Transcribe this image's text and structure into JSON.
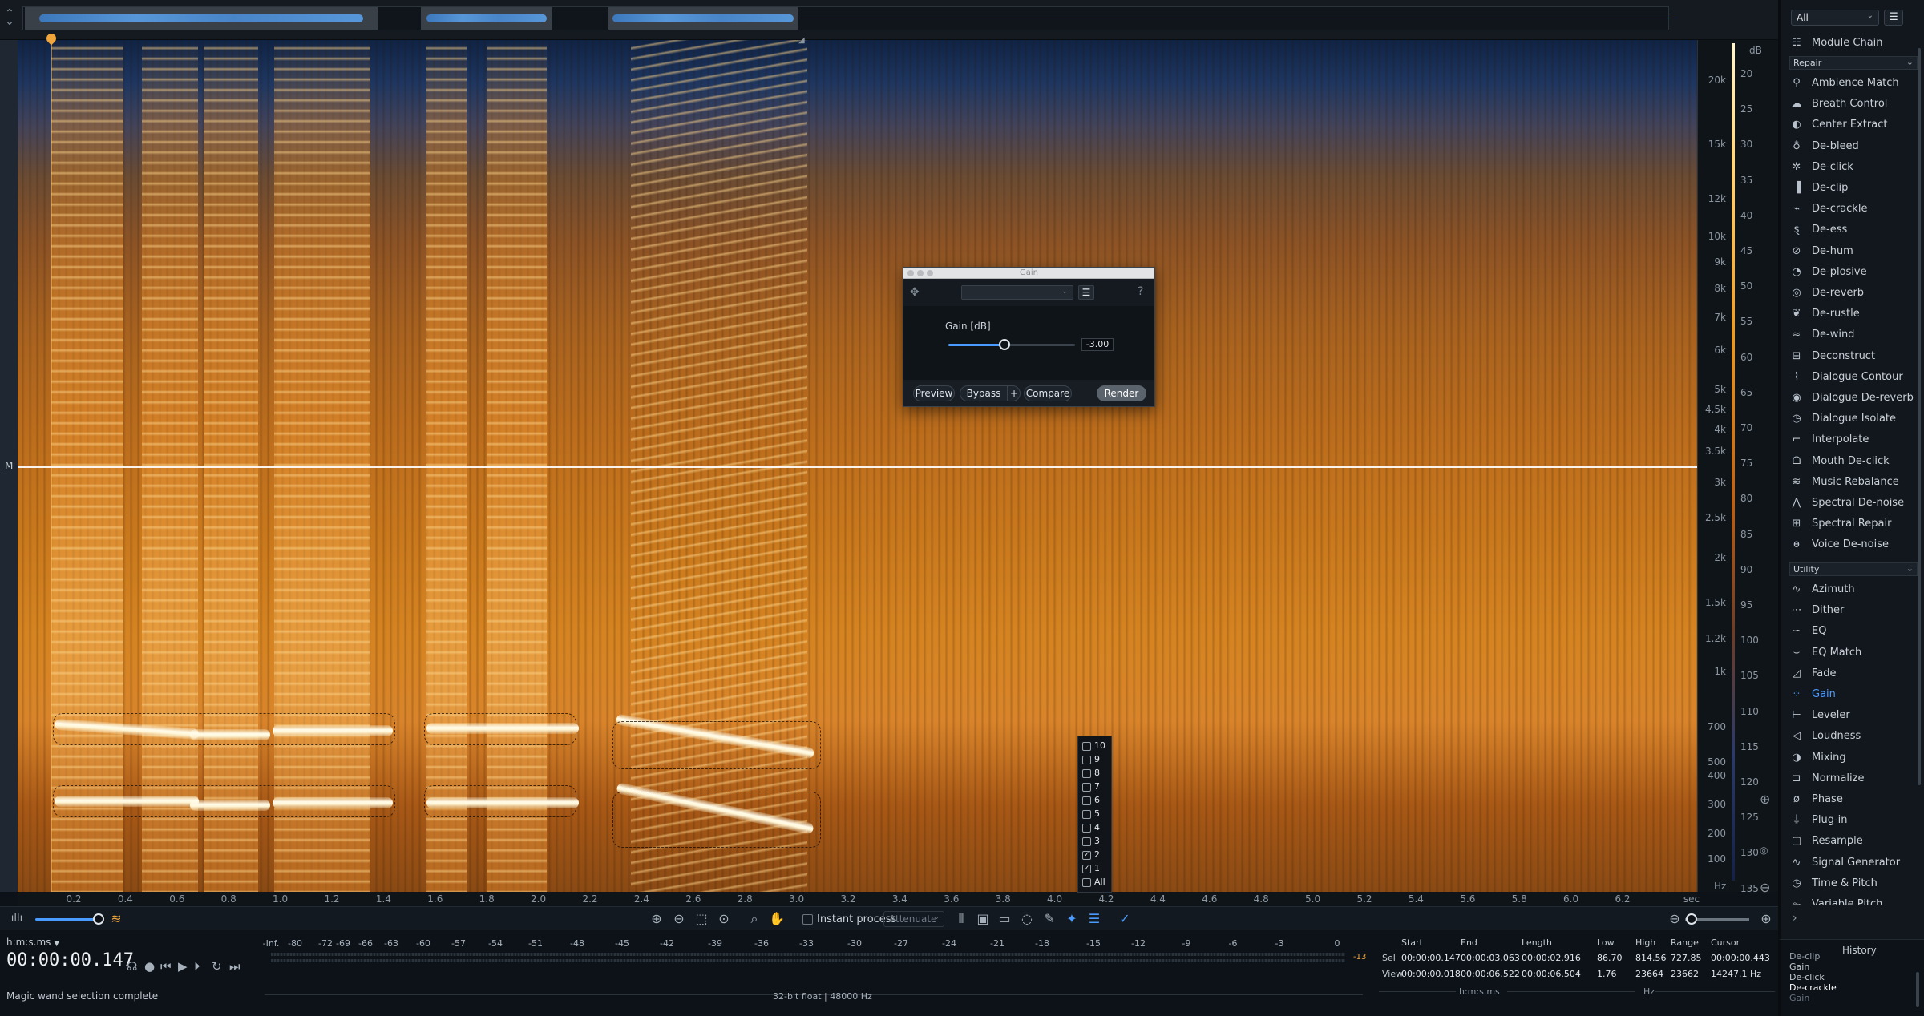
{
  "overview": {
    "collapse_icon": "collapse-icon"
  },
  "spectrogram": {
    "channel_label": "M",
    "freq_ticks": [
      "20k",
      "15k",
      "12k",
      "10k",
      "9k",
      "8k",
      "7k",
      "6k",
      "5k",
      "4.5k",
      "4k",
      "3.5k",
      "3k",
      "2.5k",
      "2k",
      "1.5k",
      "1.2k",
      "1k",
      "700",
      "500",
      "400",
      "300",
      "200",
      "100"
    ],
    "freq_unit": "Hz",
    "db_title": "dB",
    "db_ticks": [
      "20",
      "25",
      "30",
      "35",
      "40",
      "45",
      "50",
      "55",
      "60",
      "65",
      "70",
      "75",
      "80",
      "85",
      "90",
      "95",
      "100",
      "105",
      "110",
      "115",
      "120",
      "125",
      "130",
      "135"
    ],
    "time_ticks": [
      "0.2",
      "0.4",
      "0.6",
      "0.8",
      "1.0",
      "1.2",
      "1.4",
      "1.6",
      "1.8",
      "2.0",
      "2.2",
      "2.4",
      "2.6",
      "2.8",
      "3.0",
      "3.2",
      "3.4",
      "3.6",
      "3.8",
      "4.0",
      "4.2",
      "4.4",
      "4.6",
      "4.8",
      "5.0",
      "5.2",
      "5.4",
      "5.6",
      "5.8",
      "6.0",
      "6.2"
    ],
    "time_unit": "sec"
  },
  "gain_dialog": {
    "title": "Gain",
    "param_label": "Gain [dB]",
    "value": "-3.00",
    "level_fraction": 0.44,
    "preview": "Preview",
    "bypass": "Bypass",
    "plus": "+",
    "compare": "Compare",
    "render": "Render"
  },
  "harmonics_popup": {
    "items": [
      {
        "label": "10",
        "checked": false
      },
      {
        "label": "9",
        "checked": false
      },
      {
        "label": "8",
        "checked": false
      },
      {
        "label": "7",
        "checked": false
      },
      {
        "label": "6",
        "checked": false
      },
      {
        "label": "5",
        "checked": false
      },
      {
        "label": "4",
        "checked": false
      },
      {
        "label": "3",
        "checked": false
      },
      {
        "label": "2",
        "checked": true
      },
      {
        "label": "1",
        "checked": true
      },
      {
        "label": "All",
        "checked": false
      }
    ]
  },
  "toolbar": {
    "instant_process": "Instant process",
    "mode": "Attenuate"
  },
  "transport": {
    "time_format": "h:m:s.ms",
    "time": "00:00:00.147",
    "status": "Magic wand selection complete"
  },
  "meter": {
    "labels": [
      "-Inf.",
      "-80",
      "-72",
      "-69",
      "-66",
      "-63",
      "-60",
      "-57",
      "-54",
      "-51",
      "-48",
      "-45",
      "-42",
      "-39",
      "-36",
      "-33",
      "-30",
      "-27",
      "-24",
      "-21",
      "-18",
      "-15",
      "-12",
      "-9",
      "-6",
      "-3",
      "0"
    ],
    "peak": "-13",
    "format": "32-bit float | 48000 Hz"
  },
  "selection": {
    "headers": [
      "Start",
      "End",
      "Length",
      "Low",
      "High",
      "Range",
      "Cursor"
    ],
    "sel_label": "Sel",
    "view_label": "View",
    "sel": [
      "00:00:00.147",
      "00:00:03.063",
      "00:00:02.916",
      "86.70",
      "814.56",
      "727.85",
      "00:00:00.443"
    ],
    "view": [
      "00:00:00.018",
      "00:00:06.522",
      "00:00:06.504",
      "1.76",
      "23664",
      "23662",
      "14247.1 Hz"
    ],
    "time_unit": "h:m:s.ms",
    "freq_unit": "Hz"
  },
  "modules": {
    "filter": "All",
    "module_chain": "Module Chain",
    "repair_category": "Repair",
    "repair": [
      "Ambience Match",
      "Breath Control",
      "Center Extract",
      "De-bleed",
      "De-click",
      "De-clip",
      "De-crackle",
      "De-ess",
      "De-hum",
      "De-plosive",
      "De-reverb",
      "De-rustle",
      "De-wind",
      "Deconstruct",
      "Dialogue Contour",
      "Dialogue De-reverb",
      "Dialogue Isolate",
      "Interpolate",
      "Mouth De-click",
      "Music Rebalance",
      "Spectral De-noise",
      "Spectral Repair",
      "Voice De-noise"
    ],
    "utility_category": "Utility",
    "utility": [
      "Azimuth",
      "Dither",
      "EQ",
      "EQ Match",
      "Fade",
      "Gain",
      "Leveler",
      "Loudness",
      "Mixing",
      "Normalize",
      "Phase",
      "Plug-in",
      "Resample",
      "Signal Generator",
      "Time & Pitch",
      "Variable Pitch"
    ],
    "active": "Gain"
  },
  "history": {
    "title": "History",
    "entries": [
      "De-clip",
      "Gain",
      "De-click",
      "De-crackle",
      "Gain"
    ]
  }
}
